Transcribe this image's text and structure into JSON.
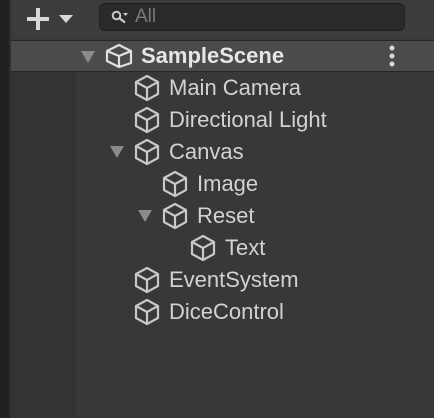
{
  "toolbar": {
    "add_icon": "plus-icon",
    "dropdown_icon": "caret-down-icon",
    "search": {
      "icon": "search-icon",
      "placeholder": "All",
      "value": ""
    }
  },
  "scene": {
    "name": "SampleScene",
    "icon": "unity-logo-icon",
    "expanded": true,
    "menu_icon": "kebab-menu-icon"
  },
  "items": [
    {
      "label": "Main Camera",
      "depth": 1,
      "expandable": false
    },
    {
      "label": "Directional Light",
      "depth": 1,
      "expandable": false
    },
    {
      "label": "Canvas",
      "depth": 1,
      "expandable": true,
      "expanded": true
    },
    {
      "label": "Image",
      "depth": 2,
      "expandable": false
    },
    {
      "label": "Reset",
      "depth": 2,
      "expandable": true,
      "expanded": true
    },
    {
      "label": "Text",
      "depth": 3,
      "expandable": false
    },
    {
      "label": "EventSystem",
      "depth": 1,
      "expandable": false
    },
    {
      "label": "DiceControl",
      "depth": 1,
      "expandable": false
    }
  ],
  "colors": {
    "panel_bg": "#383838",
    "toolbar_bg": "#3c3c3c",
    "scene_row_bg": "#4b4b4b",
    "text": "#d2d2d2",
    "icon": "#c8c8c8"
  }
}
